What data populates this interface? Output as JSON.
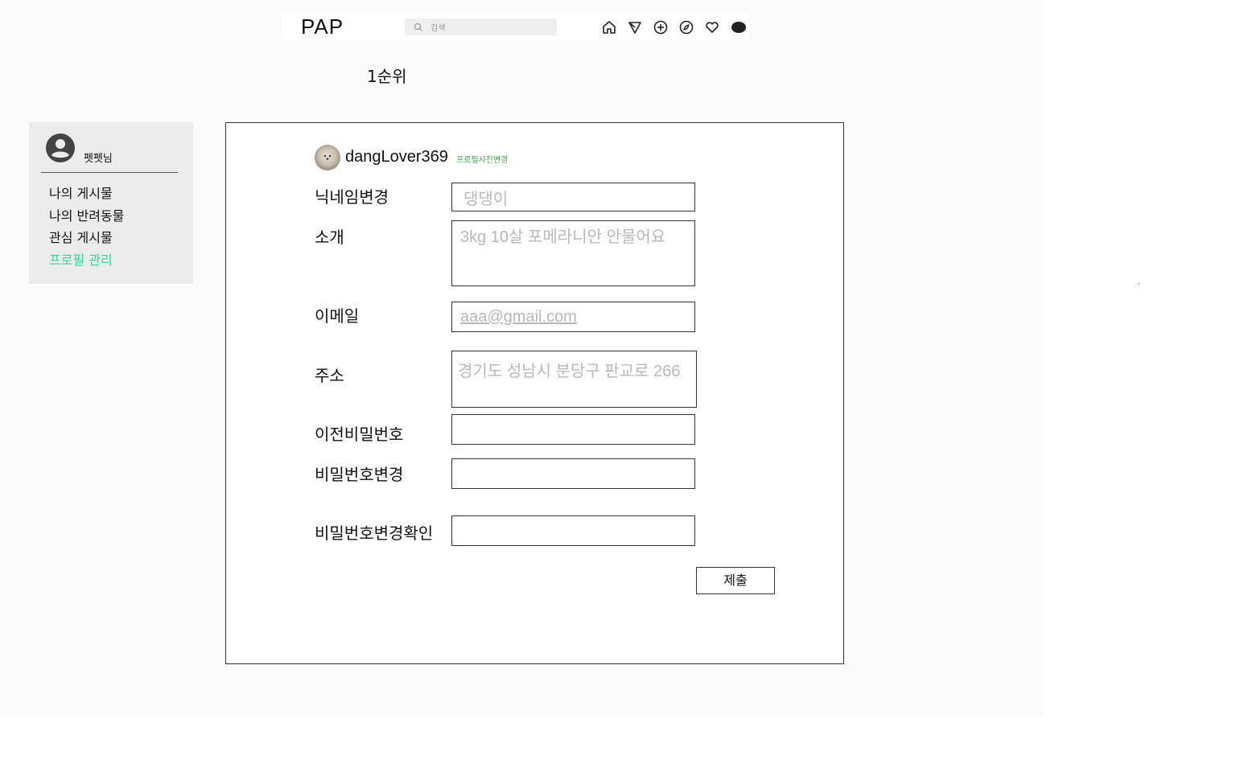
{
  "header": {
    "logo": "PAP",
    "search_placeholder": "검색",
    "icons": [
      "home-icon",
      "send-icon",
      "add-icon",
      "explore-icon",
      "heart-icon",
      "avatar-icon"
    ]
  },
  "page": {
    "rank_label": "1순위"
  },
  "sidebar": {
    "username": "펫펫님",
    "items": [
      {
        "label": "나의 게시물",
        "active": false
      },
      {
        "label": "나의 반려동물",
        "active": false
      },
      {
        "label": "관심 게시물",
        "active": false
      },
      {
        "label": "프로필 관리",
        "active": true
      }
    ],
    "active_color": "#2fd4a0"
  },
  "profile": {
    "username": "dangLover369",
    "change_photo_label": "프로필사진변경"
  },
  "form": {
    "nickname": {
      "label": "닉네임변경",
      "placeholder": "댕댕이"
    },
    "intro": {
      "label": "소개",
      "placeholder": "3kg 10살 포메라니안 안물어요"
    },
    "email": {
      "label": "이메일",
      "placeholder": "aaa@gmail.com"
    },
    "address": {
      "label": "주소",
      "placeholder": "경기도 성남시 분당구 판교로 266"
    },
    "old_password": {
      "label": "이전비밀번호",
      "value": ""
    },
    "new_password": {
      "label": "비밀번호변경",
      "value": ""
    },
    "confirm_password": {
      "label": "비밀번호변경확인",
      "value": ""
    },
    "submit_label": "제출"
  }
}
